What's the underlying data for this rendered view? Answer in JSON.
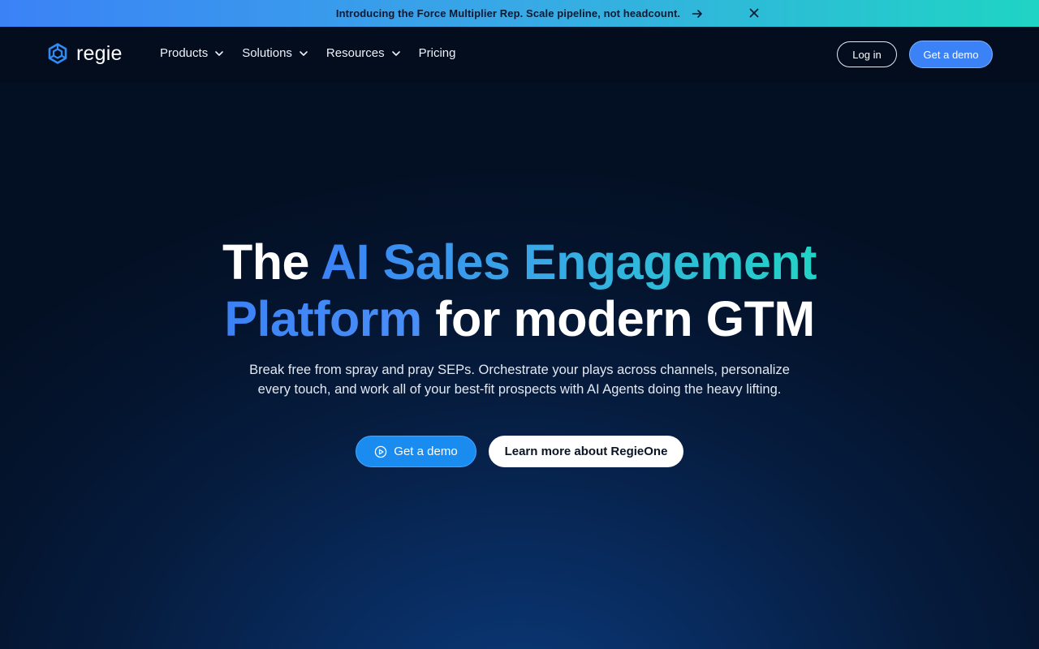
{
  "announcement": {
    "text": "Introducing the Force Multiplier Rep. Scale pipeline, not headcount.",
    "arrow_icon": "arrow-right-icon",
    "close_icon": "close-icon"
  },
  "nav": {
    "logo_text": "regie",
    "menu": [
      {
        "label": "Products",
        "has_dropdown": true
      },
      {
        "label": "Solutions",
        "has_dropdown": true
      },
      {
        "label": "Resources",
        "has_dropdown": true
      },
      {
        "label": "Pricing",
        "has_dropdown": false
      }
    ],
    "login_label": "Log in",
    "demo_label": "Get a demo"
  },
  "hero": {
    "headline_part1": "The ",
    "headline_highlight1": "AI Sales Engagement",
    "headline_highlight2": "Platform",
    "headline_part2": " for modern GTM",
    "subtitle": "Break free from spray and pray SEPs. Orchestrate your plays across channels, personalize every touch, and work all of your best-fit prospects with AI Agents doing the heavy lifting.",
    "cta_primary": "Get a demo",
    "cta_secondary": "Learn more about RegieOne"
  },
  "colors": {
    "accent_blue": "#3b82f6",
    "accent_teal": "#22d3c5",
    "background": "#030f22"
  }
}
